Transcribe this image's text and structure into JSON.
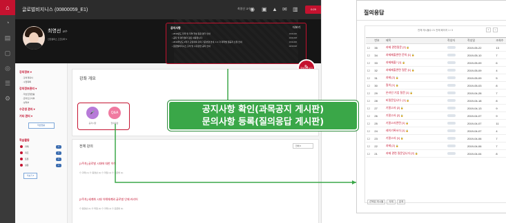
{
  "rail": [
    "⌂",
    "◔",
    "▤",
    "▢",
    "◎",
    "☰",
    "⚙"
  ],
  "topbar": {
    "title": "글로벌비지니스 (00800059_E1)",
    "user": "최영선 교수님",
    "icons": [
      "◉",
      "▣",
      "▲",
      "✉",
      "▥"
    ],
    "clock": "0:29"
  },
  "banner": {
    "prof_name": "최영선",
    "prof_suffix": "교수",
    "meta": "인천캠퍼스    고급강좌 ▾",
    "notice_title": "공지사항",
    "notice_header": "더보기",
    "notices": [
      {
        "text": "2019년도 전국 및 지역 학생 참관 평가 안내",
        "date": "19/11/20"
      },
      {
        "text": "공지 및 평가결과 검토 내용입니다.",
        "date": "19/11/08"
      },
      {
        "text": "2019학년도 2학기 교양과목 강의 기준변경 안내, 1:1 각 대학별 웹공지 신청 안내",
        "date": "19/11/06"
      },
      {
        "text": "글로벌비지니스 출석 및 수강관련 공지 안내",
        "date": "19/10/28"
      }
    ],
    "fab_icon": "✎",
    "fab_label": "학생모드 보기"
  },
  "sidebar": {
    "section1": "강의정보 ▾",
    "section1_items": [
      "· 강의계획서",
      "· 수업목록"
    ],
    "section2": "강의정보관리 ▾",
    "section2_items": [
      "· 학습진행현황",
      "· 온라인출석부",
      "· 성적부"
    ],
    "section3": "수강생 관리 ▾",
    "section4": "기타 관리 ▾",
    "button": "학습현황",
    "learn_title": "학습활동",
    "learn_rows": [
      {
        "label": "과제",
        "count": "0"
      },
      {
        "label": "퀴즈",
        "count": "0"
      },
      {
        "label": "토론",
        "count": "0"
      },
      {
        "label": "설문",
        "count": "0"
      }
    ],
    "more": "더보기 ▾"
  },
  "main": {
    "overview_title": "강좌 개요",
    "notice_icon_text": "🎤",
    "notice_label": "공지사항",
    "qa_icon_text": "Q&A",
    "qa_label": "질의응답",
    "all_lectures": "전체 강의",
    "sort": "전체",
    "lectures": [
      {
        "title": "[1주차] 글로벌 시대에 대한 이해",
        "meta": "⊙ 과제 (1)   ⊙ 동영상 (1)   ⊙ 파일 (1)   ⊙ 토론방 (1)"
      },
      {
        "title": "[2주차] 세계화 시대 이해체계와 글로벌 인재 커리어",
        "meta": "⊙ 동영상 (1)   ⊙ 파일 (1)   ⊙ 과제 (1)   ⊙ 토론방 (1)"
      }
    ]
  },
  "callout": {
    "line1": "공지사항 확인(과목공지 게시판)",
    "line2": "문의사항 등록(질의응답 게시판)"
  },
  "board": {
    "title": "질의응답",
    "pager_info": "전체 게시물수 21  전체 페이지 1 / 3",
    "pager_buttons": [
      "1",
      "»"
    ],
    "headers": [
      "",
      "번호",
      "제목",
      "작성자",
      "작성일",
      "조회수"
    ],
    "rows": [
      {
        "no": "35",
        "title": "과제 관련질문 [2]",
        "date": "2019-05-22",
        "views": "13"
      },
      {
        "no": "34",
        "title": "과제제출관련 문의 [1]",
        "date": "2019-05-10",
        "views": "7"
      },
      {
        "no": "33",
        "title": "과제제출? [1]",
        "date": "2019-05-09",
        "views": "6"
      },
      {
        "no": "32",
        "title": "과제제출관련 질문 [1]",
        "date": "2019-05-09",
        "views": "4"
      },
      {
        "no": "31",
        "title": "과제 [2]",
        "date": "2019-05-09",
        "views": "5"
      },
      {
        "no": "30",
        "title": "질의 [1]",
        "date": "2019-05-03",
        "views": "8"
      },
      {
        "no": "29",
        "title": "온라인 기업 질문 [1]",
        "date": "2019-04-28",
        "views": "7"
      },
      {
        "no": "28",
        "title": "비밀문입니다. [1]",
        "date": "2019-04-18",
        "views": "8"
      },
      {
        "no": "27",
        "title": "기말고사 [2]",
        "date": "2019-04-13",
        "views": "9"
      },
      {
        "no": "26",
        "title": "기말고사 [2]",
        "date": "2019-04-07",
        "views": "9"
      },
      {
        "no": "25",
        "title": "기말고사관련 [1]",
        "date": "2019-04-07",
        "views": "11"
      },
      {
        "no": "24",
        "title": "레이기록서식 [1]",
        "date": "2019-04-07",
        "views": "4"
      },
      {
        "no": "23",
        "title": "기말고사 [1]",
        "date": "2019-04-06",
        "views": "7"
      },
      {
        "no": "22",
        "title": "과제 [2]",
        "date": "2019-04-06",
        "views": "7"
      },
      {
        "no": "21",
        "title": "과제 관련 질문입니다 [2]",
        "date": "2019-04-04",
        "views": "8"
      }
    ],
    "foot_buttons": [
      "선택된 게시물",
      "삭제",
      "검색"
    ]
  },
  "colors": {
    "accent": "#c4122f",
    "callout": "#3aa748",
    "connector": "#3aa748"
  }
}
